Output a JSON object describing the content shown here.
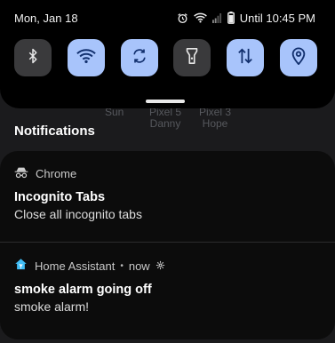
{
  "status_bar": {
    "date": "Mon, Jan 18",
    "alarm_text": "Until 10:45 PM"
  },
  "quick_settings": {
    "tiles": [
      {
        "icon": "bluetooth-icon",
        "state": "off"
      },
      {
        "icon": "wifi-icon",
        "state": "on"
      },
      {
        "icon": "auto-rotate-icon",
        "state": "on"
      },
      {
        "icon": "flashlight-icon",
        "state": "off"
      },
      {
        "icon": "mobile-data-icon",
        "state": "on"
      },
      {
        "icon": "location-icon",
        "state": "on"
      }
    ]
  },
  "background_labels": {
    "sun": "Sun",
    "pixel5_line1": "Pixel 5",
    "pixel5_line2": "Danny",
    "pixel3_line1": "Pixel 3",
    "pixel3_line2": "Hope"
  },
  "section_title": "Notifications",
  "notifications": [
    {
      "app": "Chrome",
      "app_icon": "incognito-icon",
      "title": "Incognito Tabs",
      "body": "Close all incognito tabs"
    },
    {
      "app": "Home Assistant",
      "app_icon": "home-assistant-icon",
      "time": "now",
      "title": "smoke alarm going off",
      "body": "smoke alarm!"
    }
  ],
  "colors": {
    "tile_on": "#a8c4fb",
    "tile_off": "#3a3a3c",
    "home_assistant": "#41bdf5"
  }
}
